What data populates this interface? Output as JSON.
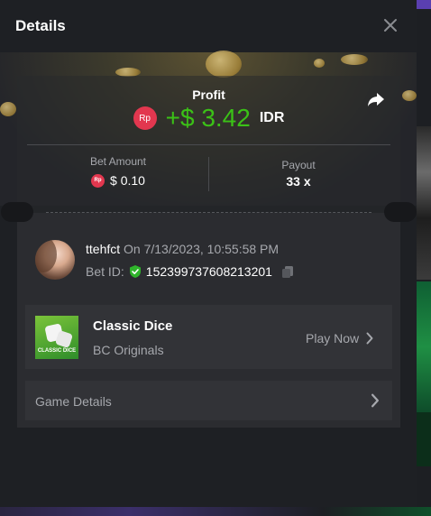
{
  "modal": {
    "title": "Details",
    "close_icon": "close-icon"
  },
  "summary": {
    "profit_label": "Profit",
    "currency_badge": "Rp",
    "profit_value": "+$ 3.42",
    "profit_currency": "IDR",
    "share_icon": "share-icon",
    "bet_amount_label": "Bet Amount",
    "bet_amount_value": "$ 0.10",
    "payout_label": "Payout",
    "payout_value": "33 x"
  },
  "bet": {
    "username": "ttehfct",
    "timestamp": "On 7/13/2023, 10:55:58 PM",
    "bet_id_label": "Bet ID:",
    "bet_id": "152399737608213201",
    "verified_icon": "shield-check-icon",
    "copy_icon": "copy-icon"
  },
  "game": {
    "title": "Classic Dice",
    "provider": "BC Originals",
    "thumb_label": "CLASSIC DICE",
    "play_label": "Play Now",
    "details_label": "Game Details"
  },
  "colors": {
    "profit_green": "#3bc117",
    "rp_badge": "#e2374f",
    "verified_green": "#2fb52b"
  }
}
